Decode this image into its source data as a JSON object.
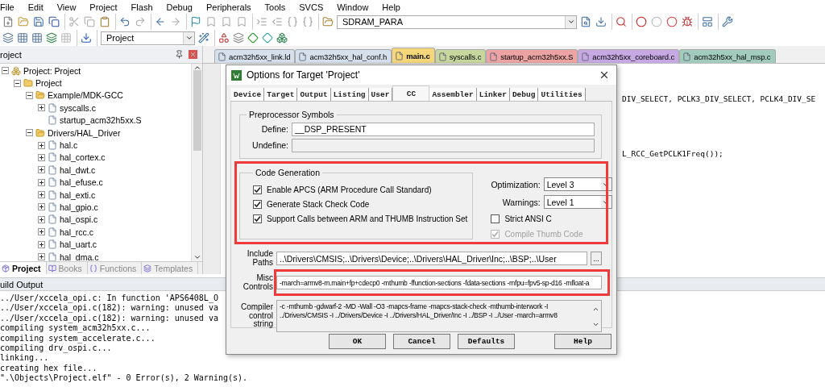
{
  "menu": [
    "File",
    "Edit",
    "View",
    "Project",
    "Flash",
    "Debug",
    "Peripherals",
    "Tools",
    "SVCS",
    "Window",
    "Help"
  ],
  "toolbar_1": {
    "target_combo": "SDRAM_PARA"
  },
  "toolbar_2": {
    "target_combo": "Project"
  },
  "project_pane": {
    "title": "roject",
    "tree": [
      {
        "label": "Project: Project",
        "expanded": true,
        "kind": "root",
        "children": [
          {
            "label": "Project",
            "expanded": true,
            "kind": "target",
            "children": [
              {
                "label": "Example/MDK-GCC",
                "expanded": true,
                "kind": "folder",
                "children": [
                  {
                    "label": "syscalls.c",
                    "expanded": false,
                    "kind": "file"
                  },
                  {
                    "label": "startup_acm32h5xx.S",
                    "kind": "file"
                  }
                ]
              },
              {
                "label": "Drivers/HAL_Driver",
                "expanded": true,
                "kind": "folder",
                "children": [
                  {
                    "label": "hal.c",
                    "expanded": false,
                    "kind": "file"
                  },
                  {
                    "label": "hal_cortex.c",
                    "expanded": false,
                    "kind": "file"
                  },
                  {
                    "label": "hal_dwt.c",
                    "expanded": false,
                    "kind": "file"
                  },
                  {
                    "label": "hal_efuse.c",
                    "expanded": false,
                    "kind": "file"
                  },
                  {
                    "label": "hal_exti.c",
                    "expanded": false,
                    "kind": "file"
                  },
                  {
                    "label": "hal_gpio.c",
                    "expanded": false,
                    "kind": "file"
                  },
                  {
                    "label": "hal_ospi.c",
                    "expanded": false,
                    "kind": "file"
                  },
                  {
                    "label": "hal_rcc.c",
                    "expanded": false,
                    "kind": "file"
                  },
                  {
                    "label": "hal_uart.c",
                    "expanded": false,
                    "kind": "file"
                  },
                  {
                    "label": "hal_dma.c",
                    "expanded": false,
                    "kind": "file"
                  }
                ]
              }
            ]
          }
        ]
      }
    ],
    "tabs": [
      {
        "label": "Project",
        "selected": true
      },
      {
        "label": "Books",
        "selected": false
      },
      {
        "label": "Functions",
        "selected": false
      },
      {
        "label": "Templates",
        "selected": false
      }
    ]
  },
  "editor": {
    "tabs": [
      {
        "label": "acm32h5xx_link.ld",
        "selected": false,
        "color": "#d6e0ec"
      },
      {
        "label": "acm32h5xx_hal_conf.h",
        "selected": false,
        "color": "#d6e0ec"
      },
      {
        "label": "main.c",
        "selected": true,
        "color": "#f5d77a"
      },
      {
        "label": "syscalls.c",
        "selected": false,
        "color": "#c7d69c"
      },
      {
        "label": "startup_acm32h5xx.S",
        "selected": false,
        "color": "#eca3a3"
      },
      {
        "label": "acm32h5xx_coreboard.c",
        "selected": false,
        "color": "#c6a9e3"
      },
      {
        "label": "acm32h5xx_hal_msp.c",
        "selected": false,
        "color": "#a0cbbd"
      }
    ],
    "visible_code": [
      "DIV_SELECT, PCLK3_DIV_SELECT, PCLK4_DIV_SE",
      "L_RCC_GetPCLK1Freq());"
    ]
  },
  "build_output": {
    "title": "uild Output",
    "lines": [
      "../User/xccela_opi.c: In function 'APS6408L_O",
      "../User/xccela_opi.c(182): warning: unused va",
      "../User/xccela_opi.c(182): warning: unused va",
      "compiling system_acm32h5xx.c...",
      "compiling system_accelerate.c...",
      "compiling drv_ospi.c...",
      "linking...",
      "creating hex file...",
      "\".\\Objects\\Project.elf\" - 0 Error(s), 2 Warning(s)."
    ]
  },
  "dialog": {
    "title": "Options for Target 'Project'",
    "tabs": [
      {
        "label": "Device",
        "selected": false
      },
      {
        "label": "Target",
        "selected": false
      },
      {
        "label": "Output",
        "selected": false
      },
      {
        "label": "Listing",
        "selected": false
      },
      {
        "label": "User",
        "selected": false
      },
      {
        "label": "CC",
        "selected": true
      },
      {
        "label": "Assembler",
        "selected": false
      },
      {
        "label": "Linker",
        "selected": false
      },
      {
        "label": "Debug",
        "selected": false
      },
      {
        "label": "Utilities",
        "selected": false
      }
    ],
    "preprocessor": {
      "title": "Preprocessor Symbols",
      "fields": [
        {
          "label": "Define:",
          "value": "__DSP_PRESENT",
          "disabled": false
        },
        {
          "label": "Undefine:",
          "disabled": true
        }
      ]
    },
    "code_generation": {
      "title": "Code Generation",
      "options": [
        {
          "label": "Enable APCS (ARM Procedure Call Standard)",
          "checked": true,
          "disabled": false
        },
        {
          "label": "Generate Stack Check Code",
          "checked": true,
          "disabled": false
        },
        {
          "label": "Support Calls between ARM and THUMB Instruction Set",
          "checked": true,
          "disabled": false
        }
      ],
      "selects": [
        {
          "label": "Optimization:",
          "value": "Level 3"
        },
        {
          "label": "Warnings:",
          "value": "Level 1"
        }
      ],
      "side_options": [
        {
          "label": "Strict ANSI C",
          "checked": false,
          "disabled": false
        },
        {
          "label": "Compile Thumb Code",
          "checked": true,
          "disabled": true
        }
      ]
    },
    "include_paths": {
      "label": "Include Paths",
      "value": "..\\Drivers\\CMSIS;..\\Drivers\\Device;..\\Drivers\\HAL_Driver\\Inc;..\\BSP;..\\User",
      "button": "..."
    },
    "misc_controls": {
      "label": "Misc Controls",
      "value": "-march=armv8-m.main+fp+cdecp0 -mthumb -ffunction-sections -fdata-sections -mfpu=fpv5-sp-d16 -mfloat-a"
    },
    "compiler_string": {
      "label": "Compiler control string",
      "lines": [
        "-c -mthumb -gdwarf-2 -MD -Wall -O3 -mapcs-frame -mapcs-stack-check -mthumb-interwork -I",
        "../Drivers/CMSIS -I ../Drivers/Device -I ../Drivers/HAL_Driver/Inc -I ../BSP -I ../User -march=armv8"
      ]
    },
    "buttons": [
      "OK",
      "Cancel",
      "Defaults",
      "Help"
    ]
  }
}
